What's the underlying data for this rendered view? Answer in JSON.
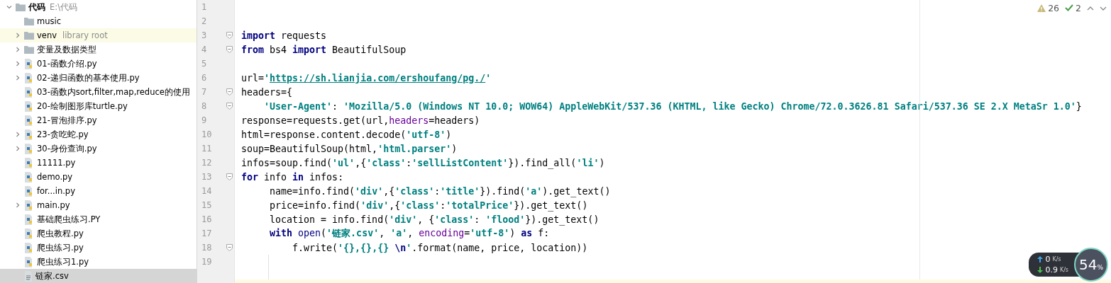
{
  "project_tree": {
    "label": "代码",
    "path": "E:\\代码",
    "expanded": true,
    "children": [
      {
        "label": "music",
        "kind": "folder",
        "selected": false
      },
      {
        "label": "venv",
        "note": "library root",
        "kind": "folder",
        "expanded": false,
        "highlighted": true,
        "selected": false
      },
      {
        "label": "变量及数据类型",
        "kind": "folder",
        "expanded": false,
        "selected": false
      },
      {
        "label": "01-函数介绍.py",
        "kind": "python",
        "expanded": false,
        "selected": false
      },
      {
        "label": "02-递归函数的基本使用.py",
        "kind": "python",
        "expanded": false,
        "selected": false
      },
      {
        "label": "03-函数内sort,filter,map,reduce的使用",
        "kind": "python",
        "selected": false
      },
      {
        "label": "20-绘制图形库turtle.py",
        "kind": "python",
        "selected": false
      },
      {
        "label": "21-冒泡排序.py",
        "kind": "python",
        "selected": false
      },
      {
        "label": "23-贪吃蛇.py",
        "kind": "python",
        "expanded": false,
        "selected": false
      },
      {
        "label": "30-身份查询.py",
        "kind": "python",
        "expanded": false,
        "selected": false
      },
      {
        "label": "11111.py",
        "kind": "python",
        "selected": false
      },
      {
        "label": "demo.py",
        "kind": "python",
        "selected": false
      },
      {
        "label": "for...in.py",
        "kind": "python",
        "selected": false
      },
      {
        "label": "main.py",
        "kind": "python",
        "expanded": false,
        "selected": false
      },
      {
        "label": "基础爬虫练习.PY",
        "kind": "python",
        "selected": false
      },
      {
        "label": "爬虫教程.py",
        "kind": "python",
        "selected": false
      },
      {
        "label": "爬虫练习.py",
        "kind": "python",
        "selected": false
      },
      {
        "label": "爬虫练习1.py",
        "kind": "python",
        "selected": false
      },
      {
        "label": "链家.csv",
        "kind": "csv",
        "selected": true
      }
    ]
  },
  "inspections": {
    "warnings": "26",
    "weak_warnings": "2"
  },
  "editor": {
    "lines": [
      {
        "number": "1"
      },
      {
        "number": "2"
      },
      {
        "number": "3",
        "fold_marker": true,
        "tokens": [
          {
            "kind": "kw",
            "text": "import"
          },
          {
            "kind": "t",
            "text": " requests"
          }
        ]
      },
      {
        "number": "4",
        "fold_marker": true,
        "tokens": [
          {
            "kind": "kw",
            "text": "from"
          },
          {
            "kind": "t",
            "text": " bs4 "
          },
          {
            "kind": "kw",
            "text": "import"
          },
          {
            "kind": "t",
            "text": " BeautifulSoup"
          }
        ]
      },
      {
        "number": "5"
      },
      {
        "number": "6",
        "tokens": [
          {
            "kind": "t",
            "text": "url="
          },
          {
            "kind": "str",
            "text": "'"
          },
          {
            "kind": "url",
            "text": "https://sh.lianjia.com/ershoufang/pg./"
          },
          {
            "kind": "str",
            "text": "'"
          }
        ]
      },
      {
        "number": "7",
        "fold_marker": true,
        "tokens": [
          {
            "kind": "t",
            "text": "headers={"
          }
        ]
      },
      {
        "number": "8",
        "fold_marker": true,
        "tokens": [
          {
            "kind": "str",
            "text": "    'User-Agent'"
          },
          {
            "kind": "t",
            "text": ": "
          },
          {
            "kind": "str",
            "text": "'Mozilla/5.0 (Windows NT 10.0; WOW64) AppleWebKit/537.36 (KHTML, like Gecko) Chrome/72.0.3626.81 Safari/537.36 SE 2.X MetaSr 1.0'"
          },
          {
            "kind": "t",
            "text": "}"
          }
        ]
      },
      {
        "number": "9",
        "tokens": [
          {
            "kind": "t",
            "text": "response=requests.get(url,"
          },
          {
            "kind": "param",
            "text": "headers"
          },
          {
            "kind": "t",
            "text": "=headers)"
          }
        ]
      },
      {
        "number": "10",
        "tokens": [
          {
            "kind": "t",
            "text": "html=response.content.decode("
          },
          {
            "kind": "str",
            "text": "'utf-8'"
          },
          {
            "kind": "t",
            "text": ")"
          }
        ]
      },
      {
        "number": "11",
        "tokens": [
          {
            "kind": "t",
            "text": "soup=BeautifulSoup(html,"
          },
          {
            "kind": "str",
            "text": "'html.parser'"
          },
          {
            "kind": "t",
            "text": ")"
          }
        ]
      },
      {
        "number": "12",
        "tokens": [
          {
            "kind": "t",
            "text": "infos=soup.find("
          },
          {
            "kind": "str",
            "text": "'ul'"
          },
          {
            "kind": "t",
            "text": ",{"
          },
          {
            "kind": "str",
            "text": "'class'"
          },
          {
            "kind": "t",
            "text": ":"
          },
          {
            "kind": "str",
            "text": "'sellListContent'"
          },
          {
            "kind": "t",
            "text": "}).find_all("
          },
          {
            "kind": "str",
            "text": "'li'"
          },
          {
            "kind": "t",
            "text": ")"
          }
        ]
      },
      {
        "number": "13",
        "fold_marker": true,
        "tokens": [
          {
            "kind": "kw",
            "text": "for"
          },
          {
            "kind": "t",
            "text": " info "
          },
          {
            "kind": "kw",
            "text": "in"
          },
          {
            "kind": "t",
            "text": " infos:"
          }
        ]
      },
      {
        "number": "14",
        "tokens": [
          {
            "kind": "t",
            "text": "     name=info.find("
          },
          {
            "kind": "str",
            "text": "'div'"
          },
          {
            "kind": "t",
            "text": ",{"
          },
          {
            "kind": "str",
            "text": "'class'"
          },
          {
            "kind": "t",
            "text": ":"
          },
          {
            "kind": "str",
            "text": "'title'"
          },
          {
            "kind": "t",
            "text": "}).find("
          },
          {
            "kind": "str",
            "text": "'a'"
          },
          {
            "kind": "t",
            "text": ").get_text()"
          }
        ]
      },
      {
        "number": "15",
        "tokens": [
          {
            "kind": "t",
            "text": "     price=info.find("
          },
          {
            "kind": "str",
            "text": "'div'"
          },
          {
            "kind": "t",
            "text": ",{"
          },
          {
            "kind": "str",
            "text": "'class'"
          },
          {
            "kind": "t",
            "text": ":"
          },
          {
            "kind": "str",
            "text": "'totalPrice'"
          },
          {
            "kind": "t",
            "text": "}).get_text()"
          }
        ]
      },
      {
        "number": "16",
        "tokens": [
          {
            "kind": "t",
            "text": "     location = info.find("
          },
          {
            "kind": "str",
            "text": "'div'"
          },
          {
            "kind": "t",
            "text": ", {"
          },
          {
            "kind": "str",
            "text": "'class'"
          },
          {
            "kind": "t",
            "text": ": "
          },
          {
            "kind": "str",
            "text": "'flood'"
          },
          {
            "kind": "t",
            "text": "}).get_text()"
          }
        ]
      },
      {
        "number": "17",
        "tokens": [
          {
            "kind": "kw",
            "text": "     with"
          },
          {
            "kind": "builtin",
            "text": " open"
          },
          {
            "kind": "t",
            "text": "("
          },
          {
            "kind": "str",
            "text": "'链家.csv'"
          },
          {
            "kind": "t",
            "text": ", "
          },
          {
            "kind": "str",
            "text": "'a'"
          },
          {
            "kind": "t",
            "text": ", "
          },
          {
            "kind": "param",
            "text": "encoding"
          },
          {
            "kind": "t",
            "text": "="
          },
          {
            "kind": "str",
            "text": "'utf-8'"
          },
          {
            "kind": "t",
            "text": ") "
          },
          {
            "kind": "kw",
            "text": "as"
          },
          {
            "kind": "t",
            "text": " f:"
          }
        ]
      },
      {
        "number": "18",
        "fold_marker": true,
        "tokens": [
          {
            "kind": "t",
            "text": "         f.write("
          },
          {
            "kind": "str",
            "text": "'{},{},{} "
          },
          {
            "kind": "esc",
            "text": "\\n"
          },
          {
            "kind": "str",
            "text": "'"
          },
          {
            "kind": "t",
            "text": ".format(name, price, location))"
          }
        ]
      },
      {
        "number": "19"
      }
    ]
  },
  "net_monitor": {
    "upload": "0",
    "upload_unit": "K/s",
    "download": "0.9",
    "download_unit": "K/s",
    "cpu": "54",
    "cpu_unit": "%"
  }
}
